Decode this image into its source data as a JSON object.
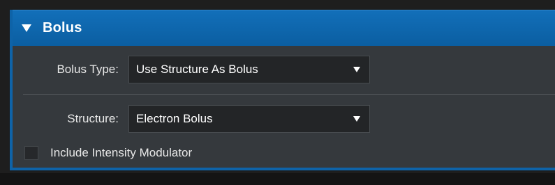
{
  "panel": {
    "title": "Bolus",
    "accent_color": "#0e63a8",
    "toggle_icon": "triangle-down-icon"
  },
  "bolus_type": {
    "label": "Bolus Type:",
    "value": "Use Structure As Bolus",
    "icon": "dropdown-arrow-icon"
  },
  "structure": {
    "label": "Structure:",
    "value": "Electron Bolus",
    "icon": "dropdown-arrow-icon"
  },
  "include_modulator": {
    "label": "Include Intensity Modulator",
    "checked": false
  }
}
